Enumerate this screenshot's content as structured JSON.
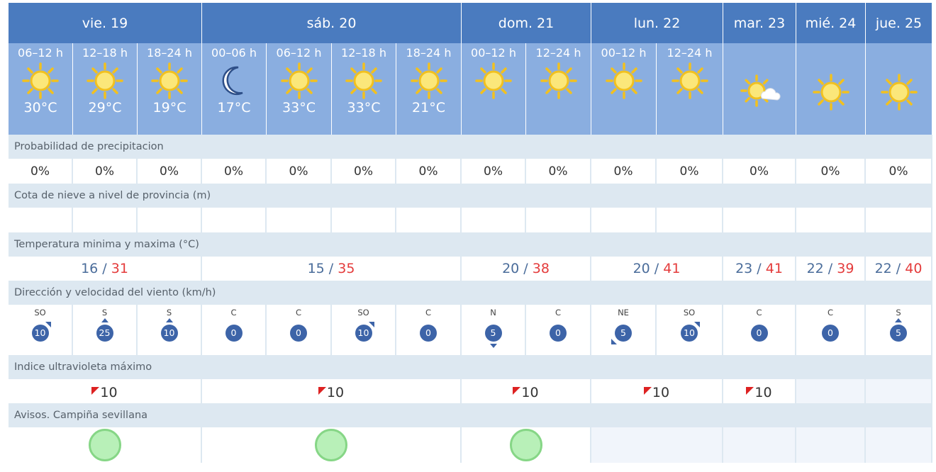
{
  "days": [
    {
      "label": "vie. 19"
    },
    {
      "label": "sáb. 20"
    },
    {
      "label": "dom. 21"
    },
    {
      "label": "lun. 22"
    },
    {
      "label": "mar. 23"
    },
    {
      "label": "mié. 24"
    },
    {
      "label": "jue. 25"
    }
  ],
  "periods": [
    {
      "time": "06–12 h",
      "icon": "sun-icon",
      "temp": "30°C"
    },
    {
      "time": "12–18 h",
      "icon": "sun-icon",
      "temp": "29°C"
    },
    {
      "time": "18–24 h",
      "icon": "sun-icon",
      "temp": "19°C"
    },
    {
      "time": "00–06 h",
      "icon": "moon-icon",
      "temp": "17°C"
    },
    {
      "time": "06–12 h",
      "icon": "sun-icon",
      "temp": "33°C"
    },
    {
      "time": "12–18 h",
      "icon": "sun-icon",
      "temp": "33°C"
    },
    {
      "time": "18–24 h",
      "icon": "sun-icon",
      "temp": "21°C"
    },
    {
      "time": "00–12 h",
      "icon": "sun-icon",
      "temp": ""
    },
    {
      "time": "12–24 h",
      "icon": "sun-icon",
      "temp": ""
    },
    {
      "time": "00–12 h",
      "icon": "sun-icon",
      "temp": ""
    },
    {
      "time": "12–24 h",
      "icon": "sun-icon",
      "temp": ""
    },
    {
      "time": "",
      "icon": "sun-cloud-icon",
      "temp": ""
    },
    {
      "time": "",
      "icon": "sun-icon",
      "temp": ""
    },
    {
      "time": "",
      "icon": "sun-icon",
      "temp": ""
    }
  ],
  "sections": {
    "precip_label": "Probabilidad de precipitacion",
    "snow_label": "Cota de nieve a nivel de provincia (m)",
    "temp_label": "Temperatura minima y maxima (°C)",
    "wind_label": "Dirección y velocidad del viento (km/h)",
    "uv_label": "Indice ultravioleta máximo",
    "alerts_label": "Avisos. Campiña sevillana"
  },
  "precip": [
    "0%",
    "0%",
    "0%",
    "0%",
    "0%",
    "0%",
    "0%",
    "0%",
    "0%",
    "0%",
    "0%",
    "0%",
    "0%",
    "0%"
  ],
  "temps": [
    {
      "min": "16",
      "sep": " / ",
      "max": "31"
    },
    {
      "min": "15",
      "sep": " / ",
      "max": "35"
    },
    {
      "min": "20",
      "sep": " / ",
      "max": "38"
    },
    {
      "min": "20",
      "sep": " / ",
      "max": "41"
    },
    {
      "min": "23",
      "sep": " / ",
      "max": "41"
    },
    {
      "min": "22",
      "sep": " / ",
      "max": "39"
    },
    {
      "min": "22",
      "sep": " / ",
      "max": "40"
    }
  ],
  "wind": [
    {
      "dir": "SO",
      "speed": "10",
      "arrow": "ne"
    },
    {
      "dir": "S",
      "speed": "25",
      "arrow": "n"
    },
    {
      "dir": "S",
      "speed": "10",
      "arrow": "n"
    },
    {
      "dir": "C",
      "speed": "0",
      "arrow": "none"
    },
    {
      "dir": "C",
      "speed": "0",
      "arrow": "none"
    },
    {
      "dir": "SO",
      "speed": "10",
      "arrow": "ne"
    },
    {
      "dir": "C",
      "speed": "0",
      "arrow": "none"
    },
    {
      "dir": "N",
      "speed": "5",
      "arrow": "s"
    },
    {
      "dir": "C",
      "speed": "0",
      "arrow": "none"
    },
    {
      "dir": "NE",
      "speed": "5",
      "arrow": "sw"
    },
    {
      "dir": "SO",
      "speed": "10",
      "arrow": "ne"
    },
    {
      "dir": "C",
      "speed": "0",
      "arrow": "none"
    },
    {
      "dir": "C",
      "speed": "0",
      "arrow": "none"
    },
    {
      "dir": "S",
      "speed": "5",
      "arrow": "n"
    }
  ],
  "uv": [
    "10",
    "10",
    "10",
    "10",
    "10",
    "",
    ""
  ],
  "alerts": [
    {
      "level": "green",
      "color": "#b8f0b8"
    },
    {
      "level": "green",
      "color": "#b8f0b8"
    },
    {
      "level": "green",
      "color": "#b8f0b8"
    },
    {
      "level": "none"
    },
    {
      "level": "none"
    },
    {
      "level": "none"
    },
    {
      "level": "none"
    }
  ],
  "colors": {
    "day_header": "#4a7bbf",
    "period_header": "#8aaee0",
    "section_band": "#dde8f1",
    "temp_min": "#4a6c9a",
    "temp_max": "#e43b3b",
    "wind_badge": "#3d64a8",
    "uv_flag": "#dd2222",
    "alert_green": "#b8f0b8"
  }
}
